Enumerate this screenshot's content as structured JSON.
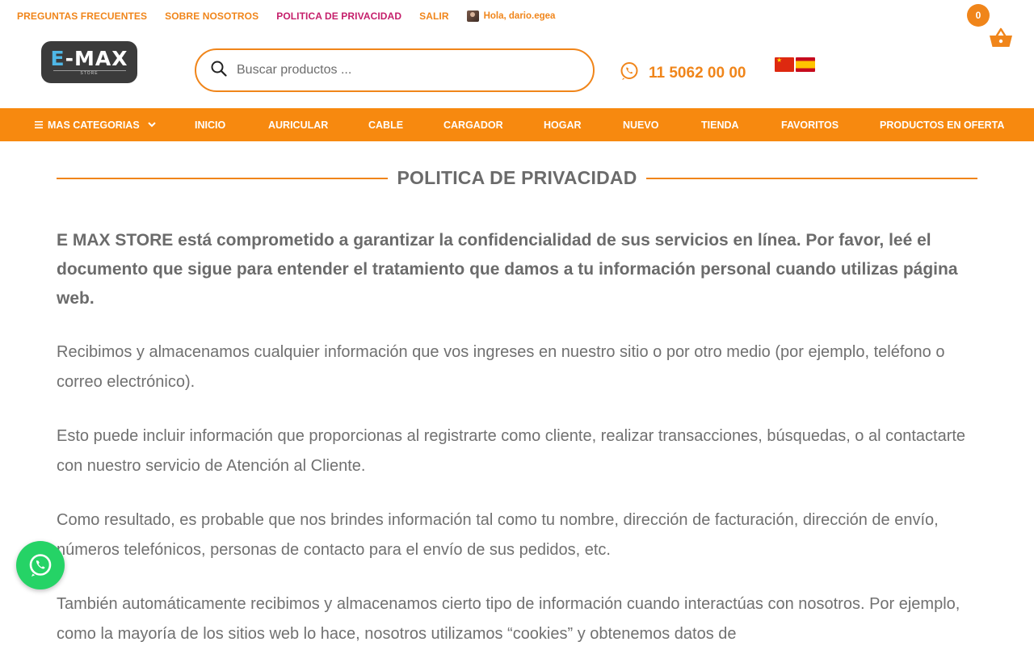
{
  "top_links": {
    "faq": "PREGUNTAS FRECUENTES",
    "about": "SOBRE NOSOTROS",
    "privacy": "POLITICA DE PRIVACIDAD",
    "logout": "SALIR",
    "greeting": "Hola, dario.egea"
  },
  "logo": {
    "text_e": "E",
    "text_rest": "-MAX",
    "sub": "STORE"
  },
  "search": {
    "placeholder": "Buscar productos ...",
    "value": ""
  },
  "phone": "11 5062 00 00",
  "cart": {
    "count": "0"
  },
  "nav": {
    "more": "MAS CATEGORIAS",
    "items": [
      "INICIO",
      "AURICULAR",
      "CABLE",
      "CARGADOR",
      "HOGAR",
      "NUEVO",
      "TIENDA",
      "FAVORITOS",
      "PRODUCTOS EN OFERTA"
    ]
  },
  "page": {
    "title": "POLITICA DE PRIVACIDAD",
    "intro": "E MAX STORE está comprometido a garantizar la confidencialidad de sus servicios en línea. Por favor, leé el documento que sigue para entender el tratamiento que damos a tu información personal cuando utilizas página web.",
    "paragraphs": [
      "Recibimos y almacenamos cualquier información que vos ingreses en nuestro sitio o por otro medio (por ejemplo, teléfono o correo electrónico).",
      "Esto puede incluir información que proporcionas al registrarte como cliente, realizar transacciones, búsquedas, o al contactarte con nuestro servicio de Atención al Cliente.",
      "Como resultado, es probable que nos brindes información tal como tu nombre, dirección de facturación, dirección de envío, números telefónicos, personas de contacto para el envío de sus pedidos, etc.",
      "También automáticamente recibimos y almacenamos cierto tipo de información cuando interactúas con nosotros. Por ejemplo, como la mayoría de los sitios web lo hace, nosotros utilizamos “cookies” y obtenemos datos de"
    ]
  },
  "colors": {
    "accent": "#f0851a",
    "active_link": "#c51f6b",
    "nav_bg": "#f7890f",
    "whatsapp": "#25d366"
  },
  "icons": [
    "search-icon",
    "whatsapp-icon",
    "cart-icon",
    "menu-icon",
    "chevron-down-icon",
    "flag-cn-icon",
    "flag-es-icon"
  ]
}
